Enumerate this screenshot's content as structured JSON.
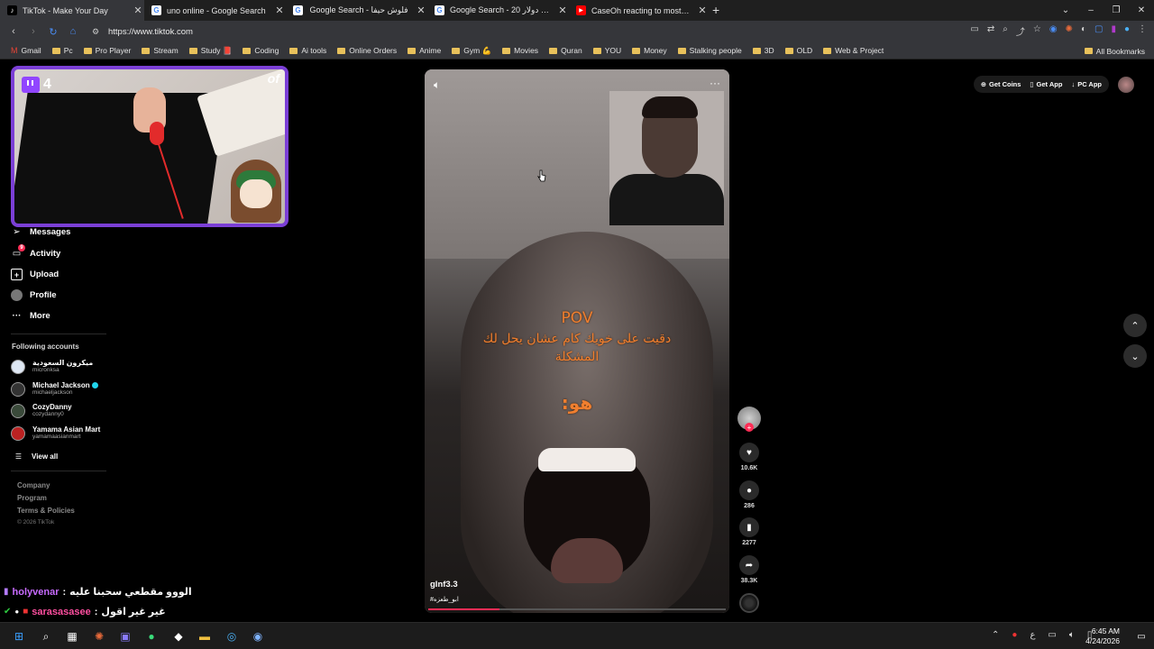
{
  "tabs": [
    {
      "title": "TikTok - Make Your Day",
      "icon": "tiktok-icon"
    },
    {
      "title": "uno online - Google Search",
      "icon": "google-icon"
    },
    {
      "title": "Google Search - فلوش حيفا",
      "icon": "google-icon"
    },
    {
      "title": "Google Search - 20 شيكل كم دولار",
      "icon": "google-icon"
    },
    {
      "title": "CaseOh reacting to most of the",
      "icon": "youtube-icon"
    }
  ],
  "address": {
    "url": "https://www.tiktok.com"
  },
  "bookmarks": [
    "Gmail",
    "Pc",
    "Pro Player",
    "Stream",
    "Study 📕",
    "Coding",
    "Ai tools",
    "Online Orders",
    "Anime",
    "Gym 💪",
    "Movies",
    "Quran",
    "YOU",
    "Money",
    "Stalking people",
    "3D",
    "OLD",
    "Web & Project"
  ],
  "all_bookmarks": "All Bookmarks",
  "cam": {
    "viewers": "4",
    "corner_mark": "of"
  },
  "nav": {
    "messages": "Messages",
    "activity": "Activity",
    "activity_badge": "9",
    "upload": "Upload",
    "profile": "Profile",
    "more": "More"
  },
  "following": {
    "title": "Following accounts",
    "accounts": [
      {
        "name": "ميكرون السعودية",
        "user": "micronksa"
      },
      {
        "name": "Michael Jackson",
        "user": "michaeljackson"
      },
      {
        "name": "CozyDanny",
        "user": "cozydanny0"
      },
      {
        "name": "Yamama Asian Mart",
        "user": "yamamaasianmart"
      }
    ],
    "view_all": "View all"
  },
  "footer": {
    "company": "Company",
    "program": "Program",
    "terms": "Terms & Policies",
    "copyright": "© 2026 TikTok"
  },
  "chat": [
    {
      "user": "holyvenar",
      "sep": ":",
      "msg": "الووو مقطعي سحبنا عليه"
    },
    {
      "user": "sarasasasee",
      "sep": ":",
      "msg": "غير غير اقول"
    }
  ],
  "video": {
    "caption_pov": "POV",
    "caption_line1": "دقيت على خويك كام عشان يحل لك",
    "caption_line2": "المشكلة",
    "caption_line3": "هو:",
    "username": "glnf3.3",
    "hashtag": "#ابو_طعزه",
    "progress": 0.24
  },
  "actions": {
    "likes": "10.6K",
    "comments": "286",
    "saves": "2277",
    "shares": "38.3K"
  },
  "topbar": {
    "get_coins": "Get Coins",
    "get_app": "Get App",
    "pc_app": "PC App"
  },
  "clock": {
    "time": "6:45 AM",
    "date": "4/24/2026"
  },
  "colors": {
    "accent": "#fe2c55",
    "twitch": "#9146ff",
    "caption": "#f07f2f"
  }
}
